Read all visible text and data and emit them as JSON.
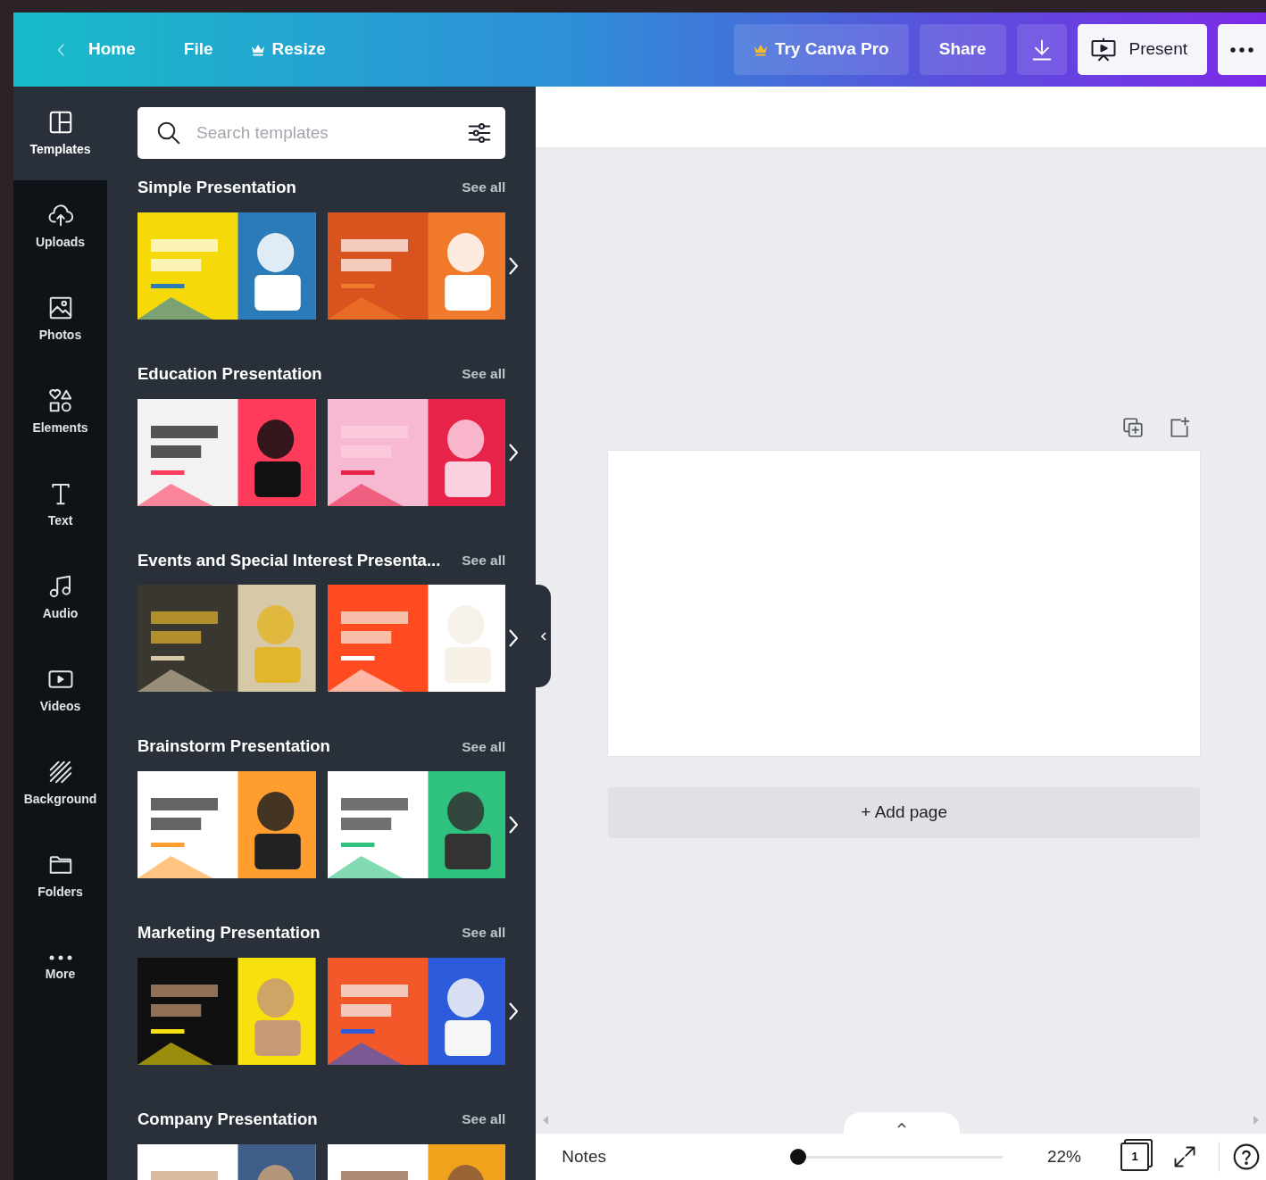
{
  "header": {
    "nav": [
      {
        "label": "Home"
      },
      {
        "label": "File"
      },
      {
        "label": "Resize"
      }
    ],
    "actions": [
      {
        "label": "Try Canva Pro",
        "kind": "pro"
      },
      {
        "label": "Share",
        "kind": "plain"
      },
      {
        "kind": "download"
      },
      {
        "label": "Present",
        "kind": "present"
      },
      {
        "kind": "more"
      }
    ]
  },
  "sidebar": {
    "items": [
      {
        "label": "Templates",
        "selected": true
      },
      {
        "label": "Uploads",
        "selected": false
      },
      {
        "label": "Photos",
        "selected": false
      },
      {
        "label": "Elements",
        "selected": false
      },
      {
        "label": "Text",
        "selected": false
      },
      {
        "label": "Audio",
        "selected": false
      },
      {
        "label": "Videos",
        "selected": false
      },
      {
        "label": "Background",
        "selected": false
      },
      {
        "label": "Folders",
        "selected": false
      },
      {
        "label": "More",
        "selected": false
      }
    ]
  },
  "panel": {
    "search": {
      "placeholder": "Search templates"
    },
    "sections": [
      {
        "title": "Simple Presentation",
        "link": "See all"
      },
      {
        "title": "Education Presentation",
        "link": "See all"
      },
      {
        "title": "Events and Special Interest Presenta...",
        "link": "See all"
      },
      {
        "title": "Brainstorm Presentation",
        "link": "See all"
      },
      {
        "title": "Marketing Presentation",
        "link": "See all"
      },
      {
        "title": "Company Presentation",
        "link": "See all"
      }
    ]
  },
  "canvas": {
    "add_page": "+ Add page"
  },
  "footer": {
    "notes": "Notes",
    "zoom": {
      "level": 0
    },
    "zoom_reading": "22%",
    "page_count": "1"
  }
}
